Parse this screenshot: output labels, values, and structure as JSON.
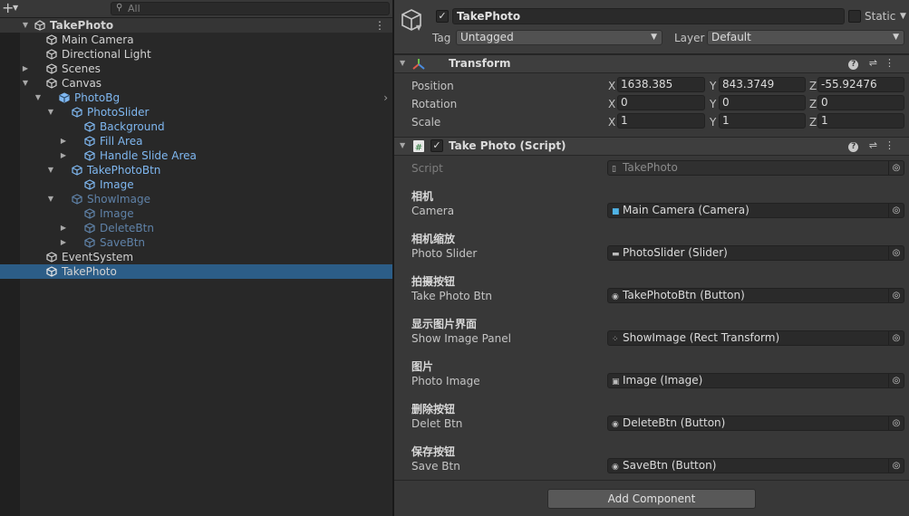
{
  "hierarchy": {
    "search_placeholder": "All",
    "scene_name": "TakePhoto",
    "items": [
      {
        "label": "Main Camera",
        "depth": 1,
        "fold": "",
        "color": "white"
      },
      {
        "label": "Directional Light",
        "depth": 1,
        "fold": "",
        "color": "white"
      },
      {
        "label": "Scenes",
        "depth": 1,
        "fold": "collapsed",
        "color": "white"
      },
      {
        "label": "Canvas",
        "depth": 1,
        "fold": "expanded",
        "color": "white"
      },
      {
        "label": "PhotoBg",
        "depth": 2,
        "fold": "expanded",
        "color": "blue",
        "prefab_root": true
      },
      {
        "label": "PhotoSlider",
        "depth": 3,
        "fold": "expanded",
        "color": "blue"
      },
      {
        "label": "Background",
        "depth": 4,
        "fold": "",
        "color": "blue"
      },
      {
        "label": "Fill Area",
        "depth": 4,
        "fold": "collapsed",
        "color": "blue"
      },
      {
        "label": "Handle Slide Area",
        "depth": 4,
        "fold": "collapsed",
        "color": "blue"
      },
      {
        "label": "TakePhotoBtn",
        "depth": 3,
        "fold": "expanded",
        "color": "blue"
      },
      {
        "label": "Image",
        "depth": 4,
        "fold": "",
        "color": "blue"
      },
      {
        "label": "ShowImage",
        "depth": 3,
        "fold": "expanded",
        "color": "dim"
      },
      {
        "label": "Image",
        "depth": 4,
        "fold": "",
        "color": "dim"
      },
      {
        "label": "DeleteBtn",
        "depth": 4,
        "fold": "collapsed",
        "color": "dim"
      },
      {
        "label": "SaveBtn",
        "depth": 4,
        "fold": "collapsed",
        "color": "dim"
      },
      {
        "label": "EventSystem",
        "depth": 1,
        "fold": "",
        "color": "white"
      },
      {
        "label": "TakePhoto",
        "depth": 1,
        "fold": "",
        "color": "white",
        "selected": true
      }
    ]
  },
  "inspector": {
    "object_name": "TakePhoto",
    "static_label": "Static",
    "tag_label": "Tag",
    "tag_value": "Untagged",
    "layer_label": "Layer",
    "layer_value": "Default",
    "transform": {
      "title": "Transform",
      "position_label": "Position",
      "rotation_label": "Rotation",
      "scale_label": "Scale",
      "axis_x": "X",
      "axis_y": "Y",
      "axis_z": "Z",
      "position": {
        "x": "1638.385",
        "y": "843.3749",
        "z": "-55.92476"
      },
      "rotation": {
        "x": "0",
        "y": "0",
        "z": "0"
      },
      "scale": {
        "x": "1",
        "y": "1",
        "z": "1"
      }
    },
    "script_component": {
      "title": "Take Photo (Script)",
      "script_label": "Script",
      "script_value": "TakePhoto",
      "fields": [
        {
          "header": "相机",
          "label": "Camera",
          "value": "Main Camera (Camera)",
          "icon": "camera-icon"
        },
        {
          "header": "相机缩放",
          "label": "Photo Slider",
          "value": "PhotoSlider (Slider)",
          "icon": "slider-icon"
        },
        {
          "header": "拍摄按钮",
          "label": "Take Photo Btn",
          "value": "TakePhotoBtn (Button)",
          "icon": "button-icon"
        },
        {
          "header": "显示图片界面",
          "label": "Show Image Panel",
          "value": "ShowImage (Rect Transform)",
          "icon": "rect-transform-icon"
        },
        {
          "header": "图片",
          "label": "Photo Image",
          "value": "Image (Image)",
          "icon": "image-icon"
        },
        {
          "header": "删除按钮",
          "label": "Delet Btn",
          "value": "DeleteBtn (Button)",
          "icon": "button-icon"
        },
        {
          "header": "保存按钮",
          "label": "Save Btn",
          "value": "SaveBtn (Button)",
          "icon": "button-icon"
        }
      ]
    },
    "add_component_label": "Add Component"
  },
  "colors": {
    "selection": "#2c5d87",
    "prefab_blue": "#7fb7f0",
    "prefab_dim": "#5f82a8"
  }
}
